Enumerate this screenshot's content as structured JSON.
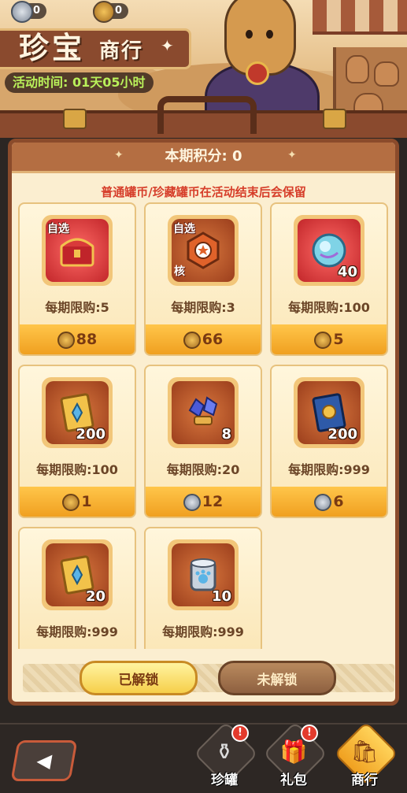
{
  "header": {
    "currency_1": "0",
    "currency_2": "0",
    "title_big": "珍宝",
    "title_small": "商行",
    "event_time_label": "活动时间:",
    "event_time_value": "01天05小时"
  },
  "panel": {
    "score_label": "本期积分:",
    "score_value": "0",
    "notice": "普通罐币/珍藏罐币在活动结束后会保留"
  },
  "items": [
    {
      "tag": "自选",
      "qty": "",
      "corner": "",
      "limit": "每期限购:5",
      "price": "88",
      "coin": "gold",
      "bg": "red",
      "icon": "treasure-chest-icon"
    },
    {
      "tag": "自选",
      "qty": "",
      "corner": "核",
      "limit": "每期限购:3",
      "price": "66",
      "coin": "gold",
      "bg": "brown",
      "icon": "star-badge-icon"
    },
    {
      "tag": "",
      "qty": "40",
      "corner": "",
      "limit": "每期限购:100",
      "price": "5",
      "coin": "gold",
      "bg": "red",
      "icon": "crystal-orb-icon"
    },
    {
      "tag": "",
      "qty": "200",
      "corner": "",
      "limit": "每期限购:100",
      "price": "1",
      "coin": "gold",
      "bg": "brown",
      "icon": "gold-ticket-icon"
    },
    {
      "tag": "",
      "qty": "8",
      "corner": "",
      "limit": "每期限购:20",
      "price": "12",
      "coin": "silver",
      "bg": "brown",
      "icon": "blue-gems-icon"
    },
    {
      "tag": "",
      "qty": "200",
      "corner": "",
      "limit": "每期限购:999",
      "price": "6",
      "coin": "silver",
      "bg": "brown",
      "icon": "blue-ticket-icon"
    },
    {
      "tag": "",
      "qty": "20",
      "corner": "",
      "limit": "每期限购:999",
      "price": "",
      "coin": "",
      "bg": "brown",
      "icon": "gold-ticket-icon"
    },
    {
      "tag": "",
      "qty": "10",
      "corner": "",
      "limit": "每期限购:999",
      "price": "",
      "coin": "",
      "bg": "brown",
      "icon": "paw-can-icon"
    }
  ],
  "tabs": {
    "unlocked": "已解锁",
    "locked": "未解锁"
  },
  "nav": {
    "jar": "珍罐",
    "gift": "礼包",
    "shop": "商行",
    "jar_badge": "!",
    "gift_badge": "!"
  }
}
